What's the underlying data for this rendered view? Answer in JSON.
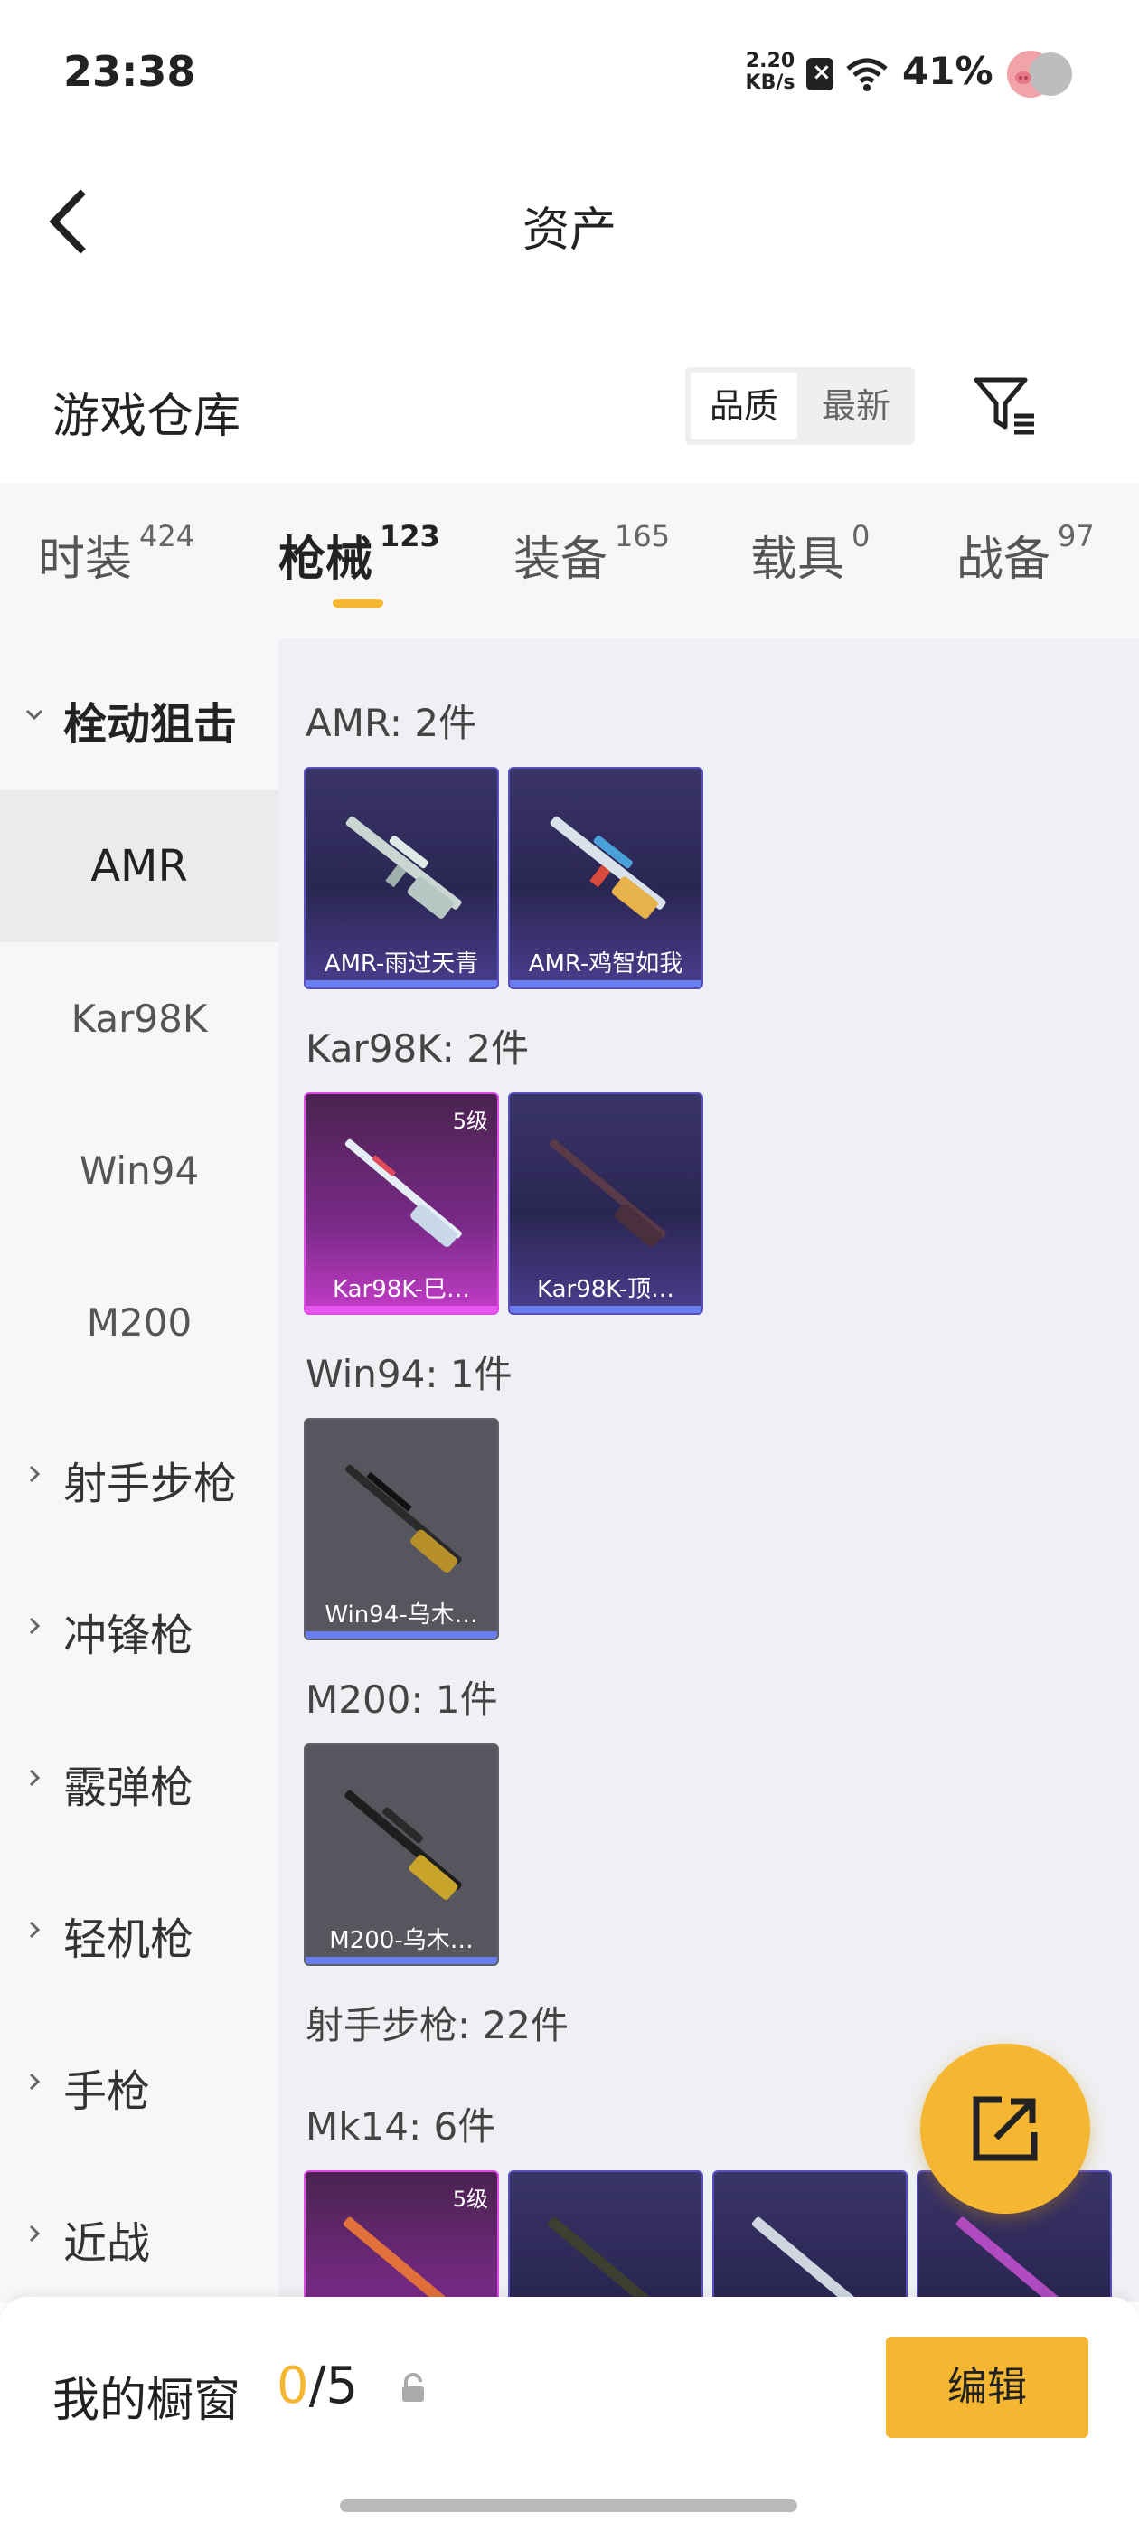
{
  "status_bar": {
    "time": "23:38",
    "net_speed_value": "2.20",
    "net_speed_unit": "KB/s",
    "battery": "41%"
  },
  "header": {
    "title": "资产"
  },
  "warehouse": {
    "title": "游戏仓库",
    "sort_options": [
      "品质",
      "最新"
    ],
    "sort_selected": "品质"
  },
  "tabs": [
    {
      "label": "时装",
      "count": "424"
    },
    {
      "label": "枪械",
      "count": "123",
      "active": true
    },
    {
      "label": "装备",
      "count": "165"
    },
    {
      "label": "载具",
      "count": "0"
    },
    {
      "label": "战备",
      "count": "97"
    }
  ],
  "sidebar": {
    "items": [
      {
        "label": "栓动狙击",
        "type": "group",
        "expanded": true
      },
      {
        "label": "AMR",
        "type": "sub",
        "selected": true
      },
      {
        "label": "Kar98K",
        "type": "sub"
      },
      {
        "label": "Win94",
        "type": "sub"
      },
      {
        "label": "M200",
        "type": "sub"
      },
      {
        "label": "射手步枪",
        "type": "group"
      },
      {
        "label": "冲锋枪",
        "type": "group"
      },
      {
        "label": "霰弹枪",
        "type": "group"
      },
      {
        "label": "轻机枪",
        "type": "group"
      },
      {
        "label": "手枪",
        "type": "group"
      },
      {
        "label": "近战",
        "type": "group"
      }
    ]
  },
  "content": {
    "groups": [
      {
        "title": "AMR: 2件",
        "items": [
          {
            "name": "AMR-雨过天青",
            "rarity": "purple"
          },
          {
            "name": "AMR-鸡智如我",
            "rarity": "purple"
          }
        ]
      },
      {
        "title": "Kar98K: 2件",
        "items": [
          {
            "name": "Kar98K-巳…",
            "rarity": "pink",
            "level": "5级"
          },
          {
            "name": "Kar98K-顶…",
            "rarity": "purple"
          }
        ]
      },
      {
        "title": "Win94: 1件",
        "items": [
          {
            "name": "Win94-乌木…",
            "rarity": "gray"
          }
        ]
      },
      {
        "title": "M200: 1件",
        "items": [
          {
            "name": "M200-乌木…",
            "rarity": "gray"
          }
        ]
      },
      {
        "title": "射手步枪: 22件",
        "items": []
      },
      {
        "title": "Mk14: 6件",
        "items": [
          {
            "name": "",
            "rarity": "pink",
            "level": "5级"
          },
          {
            "name": "",
            "rarity": "purple"
          },
          {
            "name": "",
            "rarity": "purple"
          },
          {
            "name": "",
            "rarity": "purple"
          }
        ]
      }
    ]
  },
  "bottom_bar": {
    "showcase_label": "我的橱窗",
    "showcase_current": "0",
    "showcase_total": "/5",
    "edit_label": "编辑"
  },
  "colors": {
    "accent": "#f5b731",
    "rarity_purple": "#5a4fc0",
    "rarity_pink": "#e04ae8",
    "rarity_gray": "#55565e"
  }
}
